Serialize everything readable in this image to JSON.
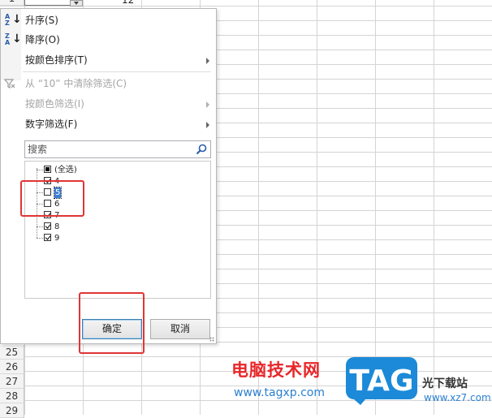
{
  "sheet": {
    "top_row": {
      "number": "1",
      "value": "12"
    },
    "rows": [
      "25",
      "26",
      "27",
      "28",
      "29"
    ]
  },
  "menu": {
    "sort_asc": "升序(S)",
    "sort_desc": "降序(O)",
    "sort_by_color": "按颜色排序(T)",
    "clear_filter": "从 “10” 中清除筛选(C)",
    "filter_by_color": "按颜色筛选(I)",
    "number_filter": "数字筛选(F)"
  },
  "search": {
    "placeholder": "搜索"
  },
  "list": [
    {
      "label": "(全选)",
      "state": "partial"
    },
    {
      "label": "4",
      "state": "checked"
    },
    {
      "label": "5",
      "state": "unchecked",
      "selected": true
    },
    {
      "label": "6",
      "state": "unchecked"
    },
    {
      "label": "7",
      "state": "checked"
    },
    {
      "label": "8",
      "state": "checked"
    },
    {
      "label": "9",
      "state": "checked"
    }
  ],
  "buttons": {
    "ok": "确定",
    "cancel": "取消"
  },
  "watermark": {
    "brand_cn": "电脑技术网",
    "url": "www.tagxp.com",
    "logo": "TAG",
    "site_cn": "光下载站",
    "site_url": "www.xz7.com"
  },
  "colors": {
    "highlight": "#e03535",
    "selection": "#3d7fd6",
    "logo_blue": "#1c8ad8"
  }
}
